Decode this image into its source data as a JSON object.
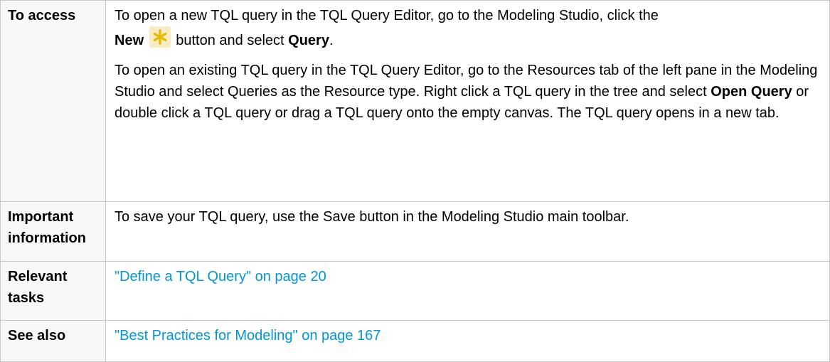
{
  "rows": {
    "access": {
      "header": "To access",
      "p1": {
        "intro": "To open a new TQL query in the TQL Query Editor, go to the Modeling Studio, click the ",
        "new_label": "New",
        "mid": " button and select ",
        "query_label": "Query",
        "end": "."
      },
      "p2": {
        "intro": "To open an existing TQL query in the TQL Query Editor, go to the Resources tab of the left pane in the Modeling Studio and select Queries as the Resource type. Right click a TQL query in the tree and select ",
        "open_label": "Open Query",
        "end": " or double click a TQL query or drag a TQL query onto the empty canvas. The TQL query opens in a new tab."
      },
      "new_icon": "new-asterisk-icon"
    },
    "important": {
      "header": "Important information",
      "text": "To save your TQL query, use the Save button in the Modeling Studio main toolbar."
    },
    "tasks": {
      "header": "Relevant tasks",
      "link": "\"Define a TQL Query\" on page 20"
    },
    "see_also": {
      "header": "See also",
      "link": "\"Best Practices for Modeling\" on page 167"
    }
  },
  "colors": {
    "link": "#0096d6",
    "border": "#c8c8c8",
    "header_bg": "#f8f8f8",
    "icon_star": "#e8b800"
  }
}
